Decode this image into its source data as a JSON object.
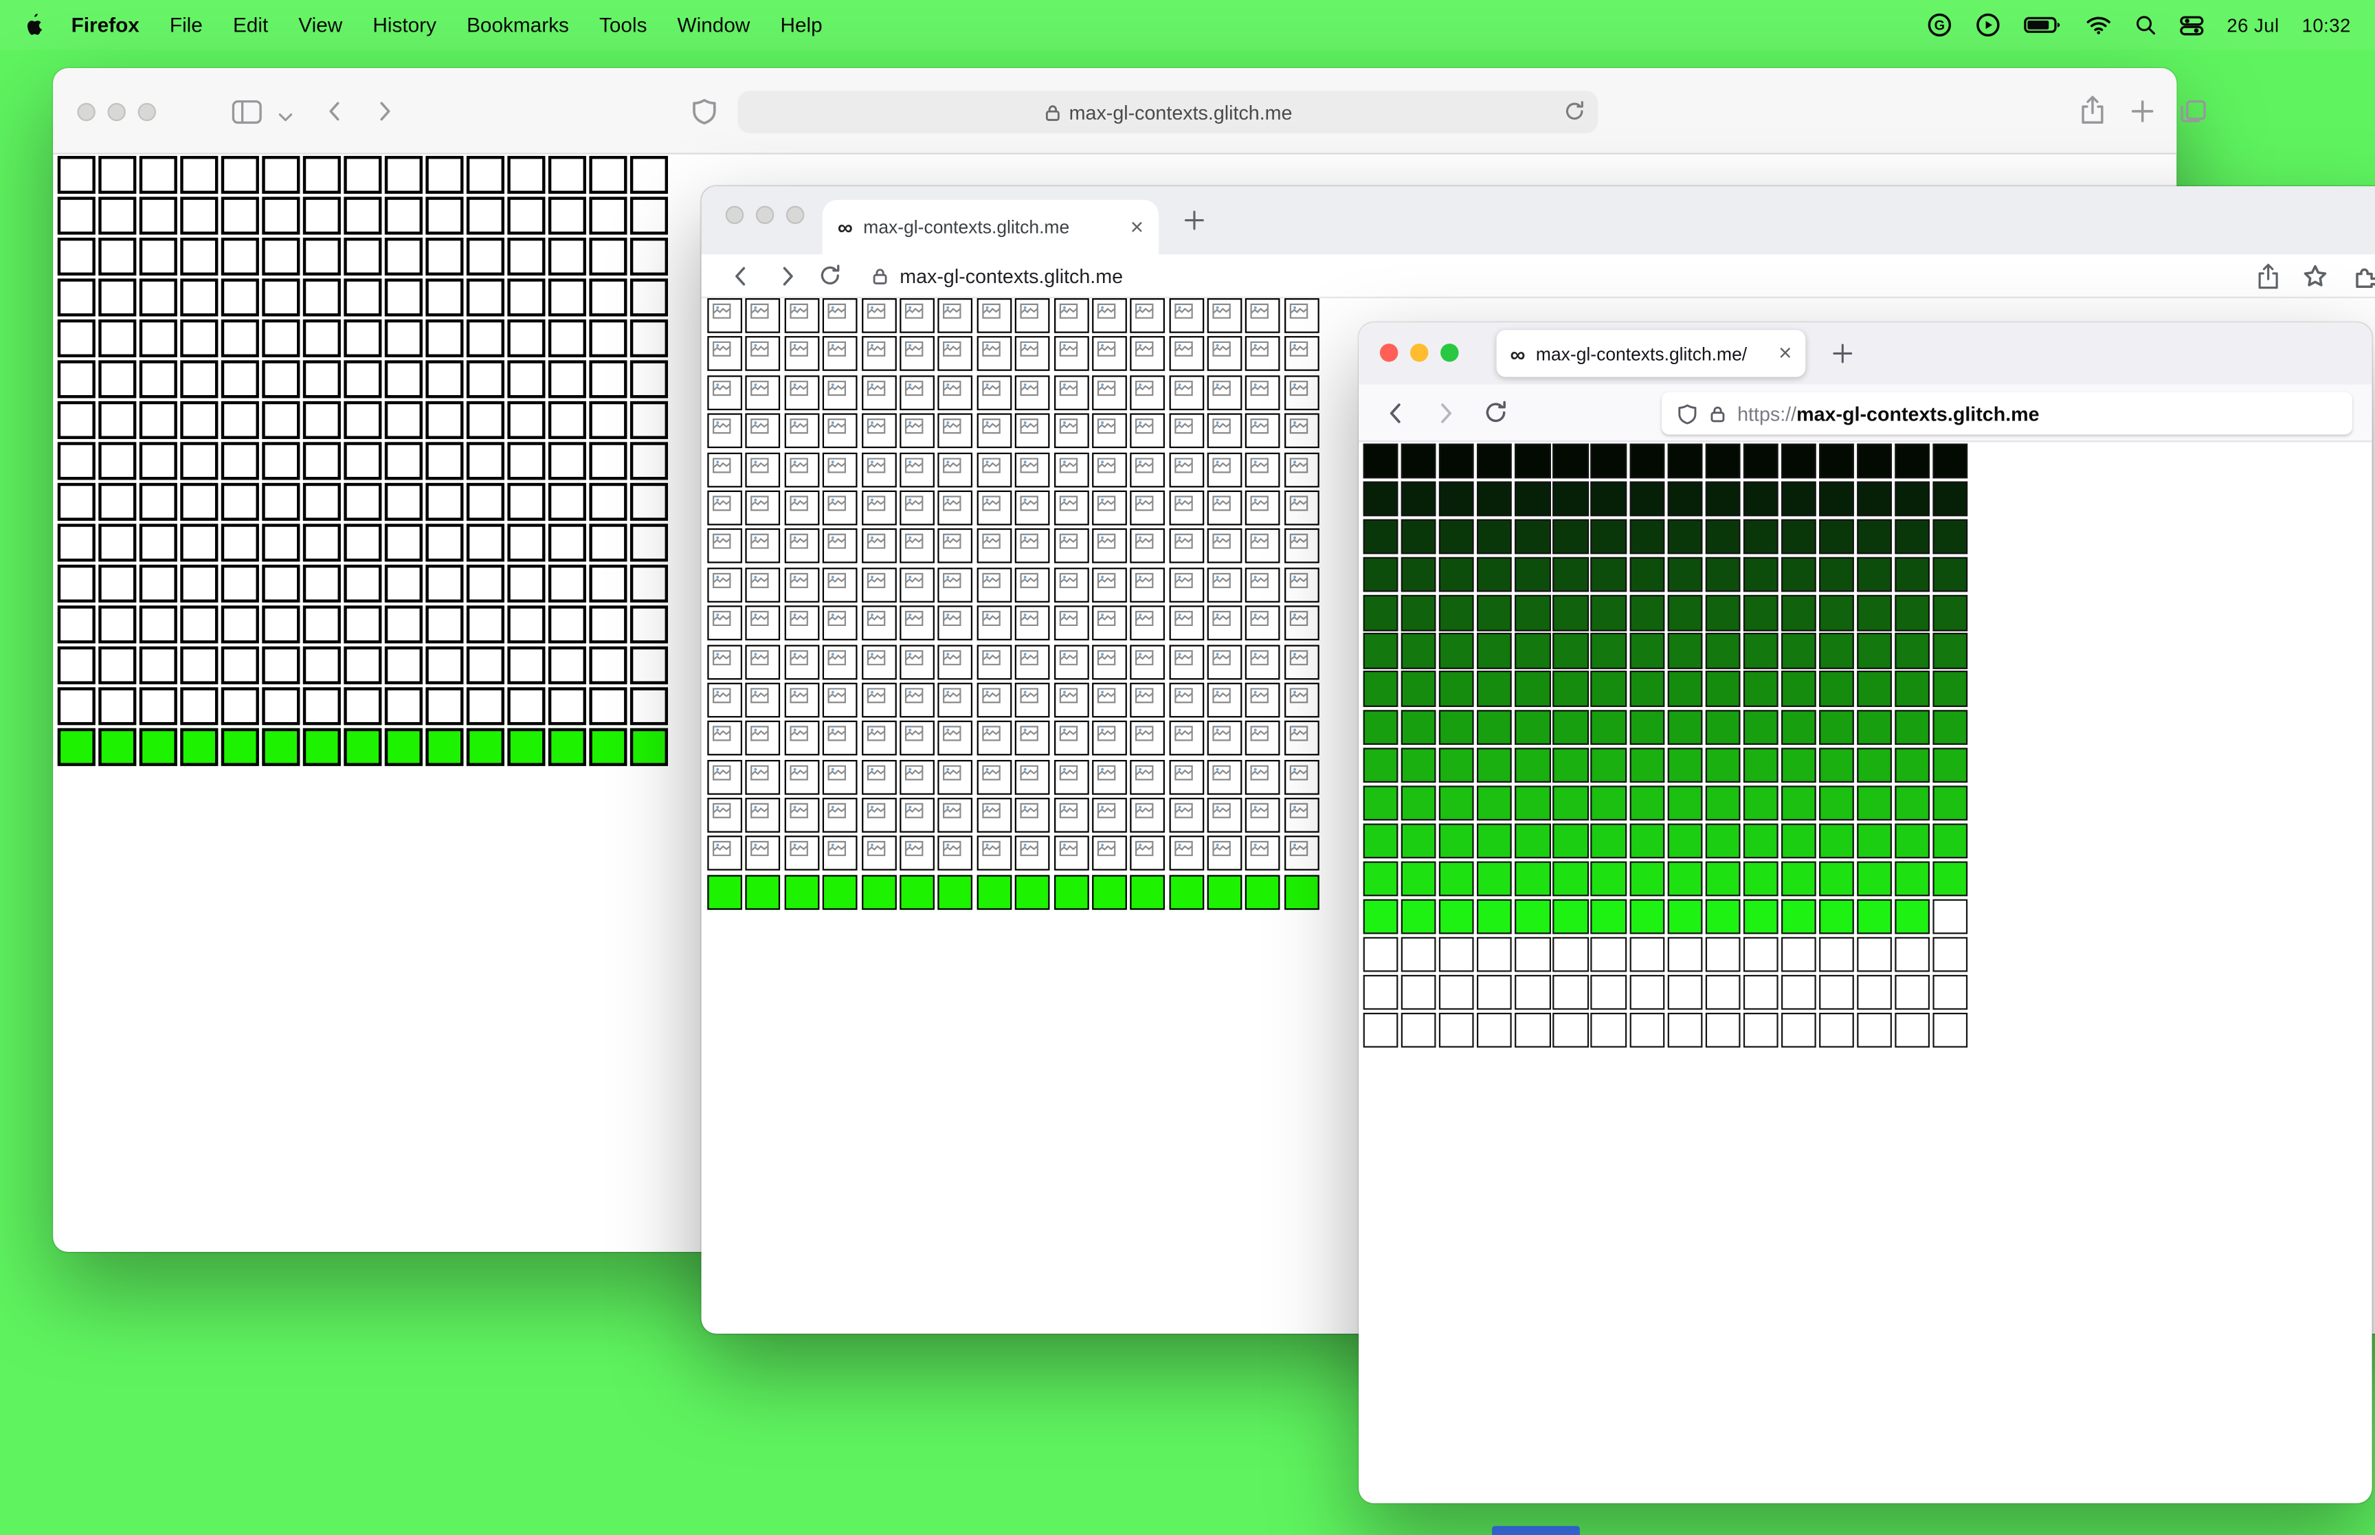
{
  "colors": {
    "desktop_bg": "#5ff45f",
    "dock_peek": "#3d7bfd",
    "lime_green": "#1df200"
  },
  "menu_bar": {
    "menus": [
      "Firefox",
      "File",
      "Edit",
      "View",
      "History",
      "Bookmarks",
      "Tools",
      "Window",
      "Help"
    ],
    "status": {
      "date": "26 Jul",
      "time": "10:32",
      "icons": [
        "grammarly-g",
        "play-circle",
        "battery",
        "wifi",
        "spotlight-search",
        "control-center"
      ]
    }
  },
  "safari_back_window": {
    "address": "max-gl-contexts.glitch.me",
    "grid": {
      "cols": 15,
      "cell": 25,
      "gap": 2,
      "border": "2px solid #000000",
      "rows": [
        {
          "fill": "#ffffff",
          "count": 14
        },
        {
          "fill": "#1df200",
          "count": 1
        }
      ]
    }
  },
  "middle_window": {
    "tab_favicon": "∞",
    "tab_title": "max-gl-contexts.glitch.me",
    "address": "max-gl-contexts.glitch.me",
    "grid": {
      "cols": 16,
      "cell": 23,
      "gap": 2.4,
      "border": "1.5px solid #000000",
      "rows": [
        {
          "fill": "#ffffff",
          "count": 15,
          "broken": true
        },
        {
          "fill": "#1df200",
          "count": 1
        }
      ]
    }
  },
  "firefox_window": {
    "tab_favicon": "∞",
    "tab_title": "max-gl-contexts.glitch.me/",
    "address_scheme": "https://",
    "address_host": "max-gl-contexts.glitch.me",
    "grid": {
      "cols": 16,
      "cell": 23.2,
      "gap": 1.9,
      "border": "1px solid #141414",
      "rows": [
        {
          "fill": "#020a02"
        },
        {
          "fill": "#062008"
        },
        {
          "fill": "#0a370a"
        },
        {
          "fill": "#0d4d0b"
        },
        {
          "fill": "#10630c"
        },
        {
          "fill": "#13780d"
        },
        {
          "fill": "#158c0e"
        },
        {
          "fill": "#179f0f"
        },
        {
          "fill": "#19b010"
        },
        {
          "fill": "#1bc010"
        },
        {
          "fill": "#1cce11"
        },
        {
          "fill": "#1ee111"
        },
        {
          "fill": "#1df212",
          "overrides": {
            "15": "#ffffff"
          }
        },
        {
          "fill": "#ffffff",
          "count": 3
        }
      ]
    }
  }
}
